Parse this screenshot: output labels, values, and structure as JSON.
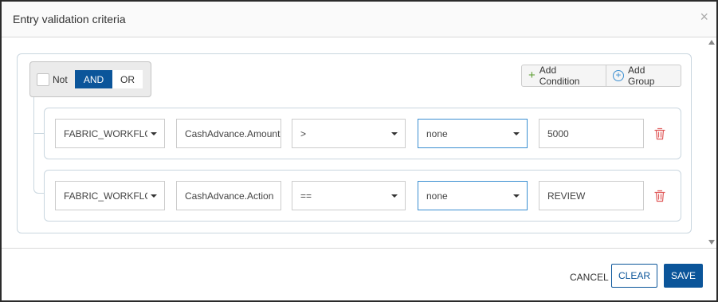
{
  "dialog": {
    "title": "Entry validation criteria",
    "close_glyph": "×"
  },
  "group": {
    "not_label": "Not",
    "not_checked": false,
    "and_label": "AND",
    "or_label": "OR",
    "active_logic": "AND",
    "add_condition_label": "Add Condition",
    "add_group_label": "Add Group"
  },
  "rules": [
    {
      "source": "FABRIC_WORKFLOW",
      "attribute": "CashAdvance.Amount",
      "operator": ">",
      "function": "none",
      "value": "5000"
    },
    {
      "source": "FABRIC_WORKFLOW",
      "attribute": "CashAdvance.Action",
      "operator": "==",
      "function": "none",
      "value": "REVIEW"
    }
  ],
  "footer": {
    "cancel_label": "CANCEL",
    "clear_label": "CLEAR",
    "save_label": "SAVE"
  },
  "colors": {
    "primary": "#0b559a",
    "add_condition_icon": "#5a9c2e",
    "add_group_icon": "#3b8fd1",
    "delete_icon": "#e05a5a"
  },
  "icons": {
    "add_condition": "plus-icon",
    "add_group": "circle-plus-icon",
    "delete_rule": "trash-icon",
    "close": "close-icon",
    "dropdown": "chevron-down-icon"
  }
}
